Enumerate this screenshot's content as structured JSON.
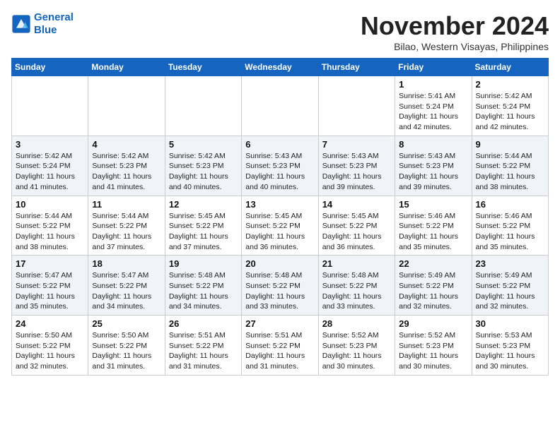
{
  "header": {
    "logo_line1": "General",
    "logo_line2": "Blue",
    "month": "November 2024",
    "location": "Bilao, Western Visayas, Philippines"
  },
  "weekdays": [
    "Sunday",
    "Monday",
    "Tuesday",
    "Wednesday",
    "Thursday",
    "Friday",
    "Saturday"
  ],
  "weeks": [
    [
      {
        "day": "",
        "info": ""
      },
      {
        "day": "",
        "info": ""
      },
      {
        "day": "",
        "info": ""
      },
      {
        "day": "",
        "info": ""
      },
      {
        "day": "",
        "info": ""
      },
      {
        "day": "1",
        "info": "Sunrise: 5:41 AM\nSunset: 5:24 PM\nDaylight: 11 hours\nand 42 minutes."
      },
      {
        "day": "2",
        "info": "Sunrise: 5:42 AM\nSunset: 5:24 PM\nDaylight: 11 hours\nand 42 minutes."
      }
    ],
    [
      {
        "day": "3",
        "info": "Sunrise: 5:42 AM\nSunset: 5:24 PM\nDaylight: 11 hours\nand 41 minutes."
      },
      {
        "day": "4",
        "info": "Sunrise: 5:42 AM\nSunset: 5:23 PM\nDaylight: 11 hours\nand 41 minutes."
      },
      {
        "day": "5",
        "info": "Sunrise: 5:42 AM\nSunset: 5:23 PM\nDaylight: 11 hours\nand 40 minutes."
      },
      {
        "day": "6",
        "info": "Sunrise: 5:43 AM\nSunset: 5:23 PM\nDaylight: 11 hours\nand 40 minutes."
      },
      {
        "day": "7",
        "info": "Sunrise: 5:43 AM\nSunset: 5:23 PM\nDaylight: 11 hours\nand 39 minutes."
      },
      {
        "day": "8",
        "info": "Sunrise: 5:43 AM\nSunset: 5:23 PM\nDaylight: 11 hours\nand 39 minutes."
      },
      {
        "day": "9",
        "info": "Sunrise: 5:44 AM\nSunset: 5:22 PM\nDaylight: 11 hours\nand 38 minutes."
      }
    ],
    [
      {
        "day": "10",
        "info": "Sunrise: 5:44 AM\nSunset: 5:22 PM\nDaylight: 11 hours\nand 38 minutes."
      },
      {
        "day": "11",
        "info": "Sunrise: 5:44 AM\nSunset: 5:22 PM\nDaylight: 11 hours\nand 37 minutes."
      },
      {
        "day": "12",
        "info": "Sunrise: 5:45 AM\nSunset: 5:22 PM\nDaylight: 11 hours\nand 37 minutes."
      },
      {
        "day": "13",
        "info": "Sunrise: 5:45 AM\nSunset: 5:22 PM\nDaylight: 11 hours\nand 36 minutes."
      },
      {
        "day": "14",
        "info": "Sunrise: 5:45 AM\nSunset: 5:22 PM\nDaylight: 11 hours\nand 36 minutes."
      },
      {
        "day": "15",
        "info": "Sunrise: 5:46 AM\nSunset: 5:22 PM\nDaylight: 11 hours\nand 35 minutes."
      },
      {
        "day": "16",
        "info": "Sunrise: 5:46 AM\nSunset: 5:22 PM\nDaylight: 11 hours\nand 35 minutes."
      }
    ],
    [
      {
        "day": "17",
        "info": "Sunrise: 5:47 AM\nSunset: 5:22 PM\nDaylight: 11 hours\nand 35 minutes."
      },
      {
        "day": "18",
        "info": "Sunrise: 5:47 AM\nSunset: 5:22 PM\nDaylight: 11 hours\nand 34 minutes."
      },
      {
        "day": "19",
        "info": "Sunrise: 5:48 AM\nSunset: 5:22 PM\nDaylight: 11 hours\nand 34 minutes."
      },
      {
        "day": "20",
        "info": "Sunrise: 5:48 AM\nSunset: 5:22 PM\nDaylight: 11 hours\nand 33 minutes."
      },
      {
        "day": "21",
        "info": "Sunrise: 5:48 AM\nSunset: 5:22 PM\nDaylight: 11 hours\nand 33 minutes."
      },
      {
        "day": "22",
        "info": "Sunrise: 5:49 AM\nSunset: 5:22 PM\nDaylight: 11 hours\nand 32 minutes."
      },
      {
        "day": "23",
        "info": "Sunrise: 5:49 AM\nSunset: 5:22 PM\nDaylight: 11 hours\nand 32 minutes."
      }
    ],
    [
      {
        "day": "24",
        "info": "Sunrise: 5:50 AM\nSunset: 5:22 PM\nDaylight: 11 hours\nand 32 minutes."
      },
      {
        "day": "25",
        "info": "Sunrise: 5:50 AM\nSunset: 5:22 PM\nDaylight: 11 hours\nand 31 minutes."
      },
      {
        "day": "26",
        "info": "Sunrise: 5:51 AM\nSunset: 5:22 PM\nDaylight: 11 hours\nand 31 minutes."
      },
      {
        "day": "27",
        "info": "Sunrise: 5:51 AM\nSunset: 5:22 PM\nDaylight: 11 hours\nand 31 minutes."
      },
      {
        "day": "28",
        "info": "Sunrise: 5:52 AM\nSunset: 5:23 PM\nDaylight: 11 hours\nand 30 minutes."
      },
      {
        "day": "29",
        "info": "Sunrise: 5:52 AM\nSunset: 5:23 PM\nDaylight: 11 hours\nand 30 minutes."
      },
      {
        "day": "30",
        "info": "Sunrise: 5:53 AM\nSunset: 5:23 PM\nDaylight: 11 hours\nand 30 minutes."
      }
    ]
  ]
}
